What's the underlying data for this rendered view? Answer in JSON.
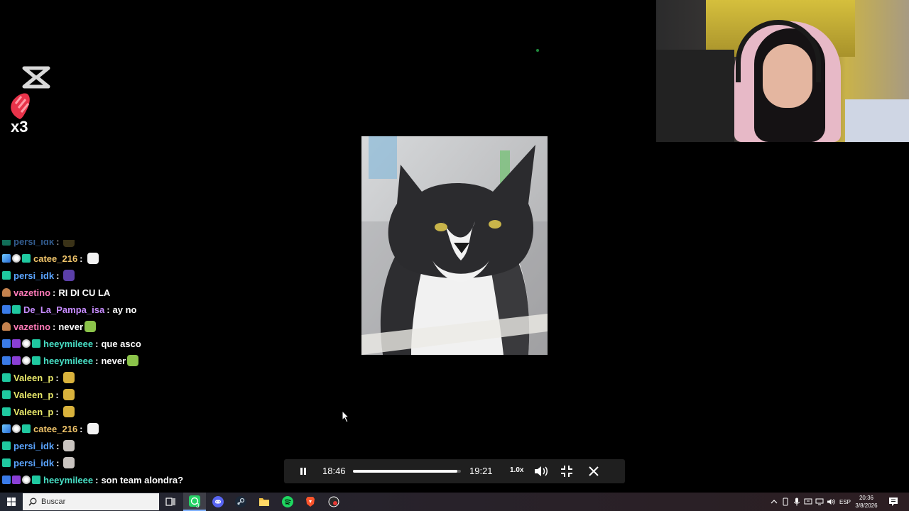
{
  "overlay": {
    "reaction_count": "x3"
  },
  "chat": {
    "messages": [
      {
        "user": "persi_idk",
        "color": "#5aa4ff",
        "message": "",
        "badges": [
          "grid"
        ],
        "emote": "#6b5c2a",
        "faded": true
      },
      {
        "user": "catee_216",
        "color": "#f0c46a",
        "message": "",
        "badges": [
          "cube",
          "cat",
          "grid"
        ],
        "emote": "#f2f2f2"
      },
      {
        "user": "persi_idk",
        "color": "#5aa4ff",
        "message": "",
        "badges": [
          "grid"
        ],
        "emote": "#5b3fa8"
      },
      {
        "user": "vazetino",
        "color": "#ff7ab8",
        "message": "RI DI CU LA",
        "badges": [
          "hat"
        ]
      },
      {
        "user": "De_La_Pampa_isa",
        "color": "#c78cff",
        "message": "ay no",
        "badges": [
          "x",
          "grid"
        ]
      },
      {
        "user": "vazetino",
        "color": "#ff7ab8",
        "message": "never",
        "badges": [
          "hat"
        ],
        "emote": "#8bc34a"
      },
      {
        "user": "heeymileee",
        "color": "#48e0c6",
        "message": "que asco",
        "badges": [
          "x",
          "purple",
          "cat",
          "grid"
        ]
      },
      {
        "user": "heeymileee",
        "color": "#48e0c6",
        "message": "never",
        "badges": [
          "x",
          "purple",
          "cat",
          "grid"
        ],
        "emote": "#8bc34a"
      },
      {
        "user": "Valeen_p",
        "color": "#e8e86a",
        "message": "",
        "badges": [
          "grid"
        ],
        "emote": "#d9b23c"
      },
      {
        "user": "Valeen_p",
        "color": "#e8e86a",
        "message": "",
        "badges": [
          "grid"
        ],
        "emote": "#d9b23c"
      },
      {
        "user": "Valeen_p",
        "color": "#e8e86a",
        "message": "",
        "badges": [
          "grid"
        ],
        "emote": "#d9b23c"
      },
      {
        "user": "catee_216",
        "color": "#f0c46a",
        "message": "",
        "badges": [
          "cube",
          "cat",
          "grid"
        ],
        "emote": "#f2f2f2"
      },
      {
        "user": "persi_idk",
        "color": "#5aa4ff",
        "message": "",
        "badges": [
          "grid"
        ],
        "emote": "#c9c4c0"
      },
      {
        "user": "persi_idk",
        "color": "#5aa4ff",
        "message": "",
        "badges": [
          "grid"
        ],
        "emote": "#c9c4c0"
      },
      {
        "user": "heeymileee",
        "color": "#48e0c6",
        "message": "son team alondra?",
        "badges": [
          "x",
          "purple",
          "cat",
          "grid"
        ]
      }
    ]
  },
  "player": {
    "elapsed": "18:46",
    "total": "19:21",
    "speed": "1.0x",
    "progress": 0.97
  },
  "taskbar": {
    "search_placeholder": "Buscar",
    "whatsapp_badge": "3",
    "language": "ESP",
    "time": "20:36",
    "date": "3/8/2026"
  },
  "colors": {
    "accent": "#7fb0ff",
    "player_bg": "#1f1f1f"
  }
}
